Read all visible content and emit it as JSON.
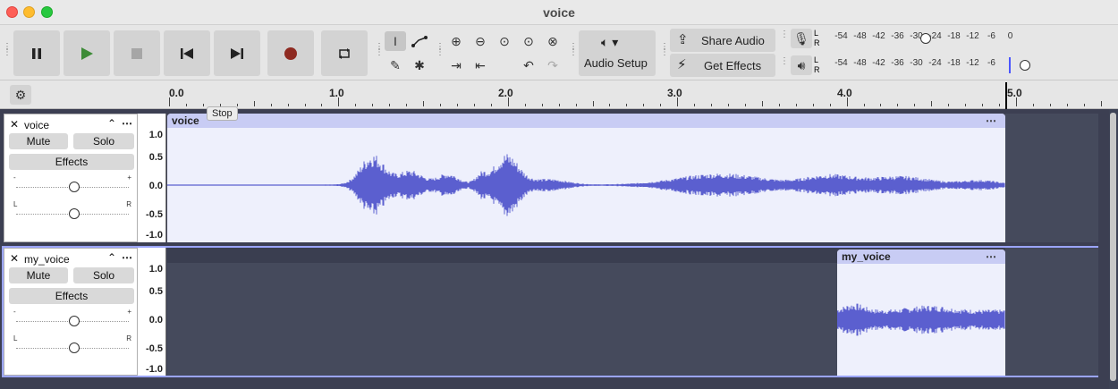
{
  "window": {
    "title": "voice"
  },
  "toolbar": {
    "share_audio": "Share Audio",
    "get_effects": "Get Effects",
    "audio_setup": "Audio Setup",
    "meter_ticks": [
      "-54",
      "-48",
      "-42",
      "-36",
      "-30",
      "-24",
      "-18",
      "-12",
      "-6",
      "0"
    ],
    "meter_L": "L",
    "meter_R": "R"
  },
  "ruler": {
    "labels": [
      "0.0",
      "1.0",
      "2.0",
      "3.0",
      "4.0",
      "5.0"
    ]
  },
  "tooltip": "Stop",
  "tracks": [
    {
      "name": "voice",
      "mute": "Mute",
      "solo": "Solo",
      "effects": "Effects",
      "clip_name": "voice",
      "scale": [
        "1.0",
        "0.5",
        "0.0",
        "-0.5",
        "-1.0"
      ],
      "gain_minus": "-",
      "gain_plus": "+",
      "pan_L": "L",
      "pan_R": "R"
    },
    {
      "name": "my_voice",
      "mute": "Mute",
      "solo": "Solo",
      "effects": "Effects",
      "clip_name": "my_voice",
      "scale": [
        "1.0",
        "0.5",
        "0.0",
        "-0.5",
        "-1.0"
      ],
      "gain_minus": "-",
      "gain_plus": "+",
      "pan_L": "L",
      "pan_R": "R"
    }
  ],
  "colors": {
    "waveform": "#5b5fcf",
    "clip_bg": "#eef0fc",
    "clip_header": "#c8ccf4",
    "track_bg": "#3c3f52",
    "selected_border": "#9ba5ff",
    "record": "#8e2a21",
    "play": "#3d8b37"
  },
  "icons": {
    "pause": "pause-icon",
    "play": "play-icon",
    "stop": "stop-icon",
    "skip_start": "skip-start-icon",
    "skip_end": "skip-end-icon",
    "record": "record-icon",
    "loop": "loop-icon"
  }
}
